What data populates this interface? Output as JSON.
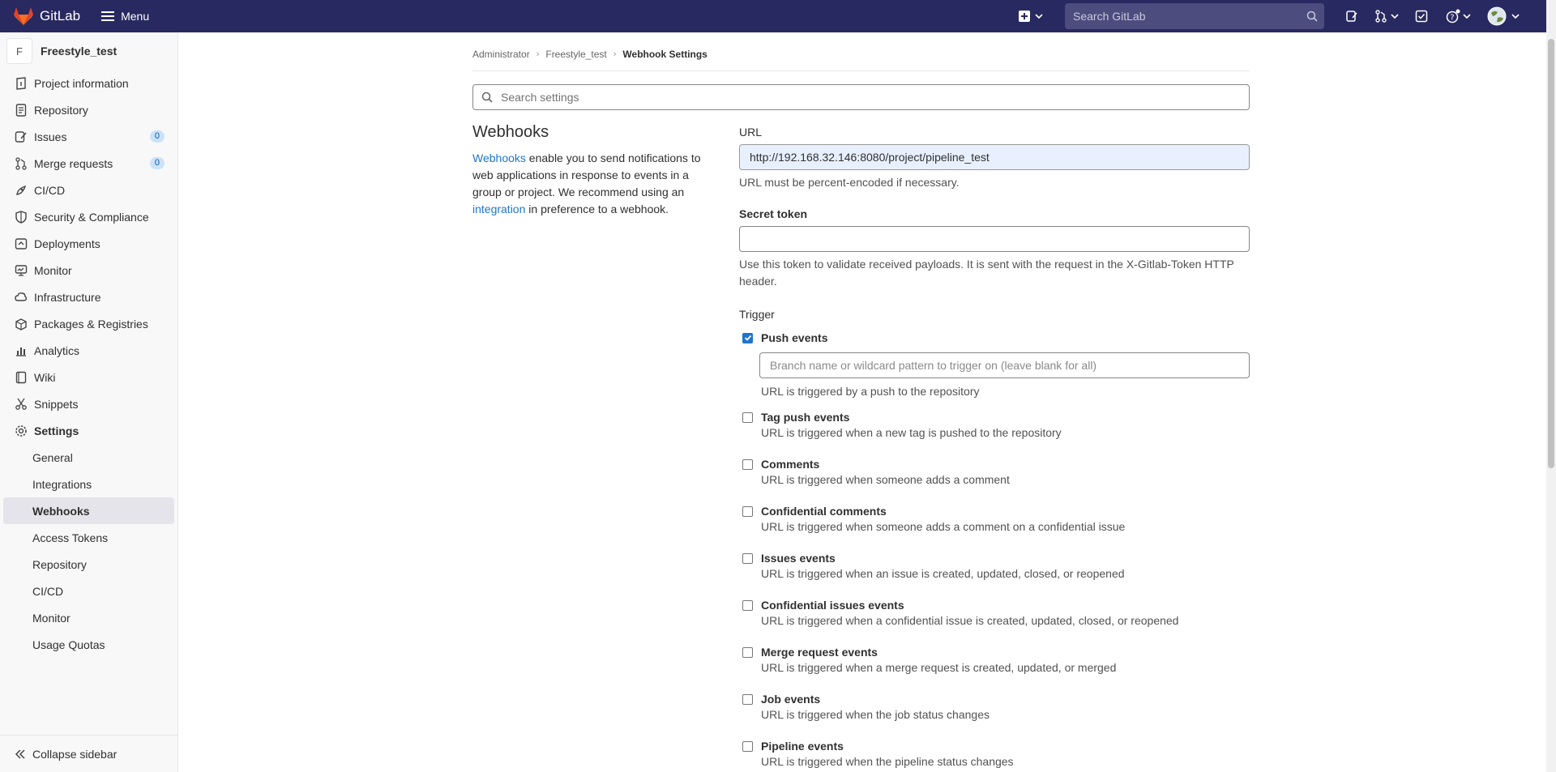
{
  "topbar": {
    "brand": "GitLab",
    "menu_label": "Menu",
    "search_placeholder": "Search GitLab"
  },
  "sidebar": {
    "project_initial": "F",
    "project_name": "Freestyle_test",
    "items": [
      {
        "label": "Project information",
        "icon": "info-icon"
      },
      {
        "label": "Repository",
        "icon": "doc-icon"
      },
      {
        "label": "Issues",
        "icon": "issues-icon",
        "count": "0"
      },
      {
        "label": "Merge requests",
        "icon": "merge-request-icon",
        "count": "0"
      },
      {
        "label": "CI/CD",
        "icon": "rocket-icon"
      },
      {
        "label": "Security & Compliance",
        "icon": "shield-icon"
      },
      {
        "label": "Deployments",
        "icon": "deployments-icon"
      },
      {
        "label": "Monitor",
        "icon": "monitor-icon"
      },
      {
        "label": "Infrastructure",
        "icon": "infrastructure-icon"
      },
      {
        "label": "Packages & Registries",
        "icon": "package-icon"
      },
      {
        "label": "Analytics",
        "icon": "chart-icon"
      },
      {
        "label": "Wiki",
        "icon": "book-icon"
      },
      {
        "label": "Snippets",
        "icon": "scissors-icon"
      },
      {
        "label": "Settings",
        "icon": "gear-icon"
      }
    ],
    "sub_items": [
      "General",
      "Integrations",
      "Webhooks",
      "Access Tokens",
      "Repository",
      "CI/CD",
      "Monitor",
      "Usage Quotas"
    ],
    "active_sub": "Webhooks",
    "collapse_label": "Collapse sidebar"
  },
  "breadcrumb": [
    "Administrator",
    "Freestyle_test",
    "Webhook Settings"
  ],
  "settings_search_placeholder": "Search settings",
  "intro": {
    "title": "Webhooks",
    "link1": "Webhooks",
    "text1": " enable you to send notifications to web applications in response to events in a group or project. We recommend using an ",
    "link2": "integration",
    "text2": " in preference to a webhook."
  },
  "form": {
    "url_label": "URL",
    "url_value": "http://192.168.32.146:8080/project/pipeline_test",
    "url_help": "URL must be percent-encoded if necessary.",
    "token_label": "Secret token",
    "token_value": "",
    "token_help": "Use this token to validate received payloads. It is sent with the request in the X-Gitlab-Token HTTP header.",
    "trigger_label": "Trigger",
    "branch_placeholder": "Branch name or wildcard pattern to trigger on (leave blank for all)"
  },
  "triggers": [
    {
      "title": "Push events",
      "desc": "URL is triggered by a push to the repository",
      "checked": true
    },
    {
      "title": "Tag push events",
      "desc": "URL is triggered when a new tag is pushed to the repository",
      "checked": false
    },
    {
      "title": "Comments",
      "desc": "URL is triggered when someone adds a comment",
      "checked": false
    },
    {
      "title": "Confidential comments",
      "desc": "URL is triggered when someone adds a comment on a confidential issue",
      "checked": false
    },
    {
      "title": "Issues events",
      "desc": "URL is triggered when an issue is created, updated, closed, or reopened",
      "checked": false
    },
    {
      "title": "Confidential issues events",
      "desc": "URL is triggered when a confidential issue is created, updated, closed, or reopened",
      "checked": false
    },
    {
      "title": "Merge request events",
      "desc": "URL is triggered when a merge request is created, updated, or merged",
      "checked": false
    },
    {
      "title": "Job events",
      "desc": "URL is triggered when the job status changes",
      "checked": false
    },
    {
      "title": "Pipeline events",
      "desc": "URL is triggered when the pipeline status changes",
      "checked": false
    }
  ],
  "colors": {
    "topbar": "#292961",
    "accent": "#1f75cb",
    "sidebar": "#f8f8f8"
  }
}
